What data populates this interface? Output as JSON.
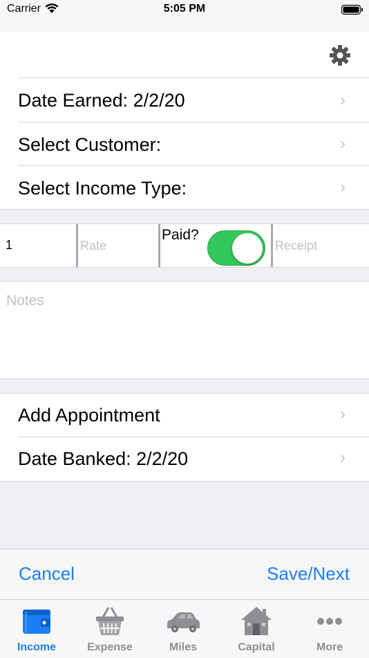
{
  "status_bar": {
    "carrier": "Carrier",
    "time": "5:05 PM"
  },
  "settings": {
    "icon": "gear-icon"
  },
  "rows_top": [
    {
      "label": "Date Earned: 2/2/20"
    },
    {
      "label": "Select Customer:"
    },
    {
      "label": "Select Income Type:"
    }
  ],
  "entry": {
    "quantity": "1",
    "rate_placeholder": "Rate",
    "paid_label": "Paid?",
    "paid_on": true,
    "receipt_placeholder": "Receipt"
  },
  "notes": {
    "placeholder": "Notes"
  },
  "rows_bottom": [
    {
      "label": "Add Appointment"
    },
    {
      "label": "Date Banked: 2/2/20"
    }
  ],
  "toolbar": {
    "cancel_label": "Cancel",
    "save_label": "Save/Next"
  },
  "tabs": [
    {
      "label": "Income",
      "icon": "wallet-icon",
      "active": true
    },
    {
      "label": "Expense",
      "icon": "basket-icon",
      "active": false
    },
    {
      "label": "Miles",
      "icon": "car-icon",
      "active": false
    },
    {
      "label": "Capital",
      "icon": "house-icon",
      "active": false
    },
    {
      "label": "More",
      "icon": "more-icon",
      "active": false
    }
  ],
  "colors": {
    "accent": "#1a7ef5",
    "toggle_on": "#34c759",
    "tab_inactive": "#8e8e93"
  }
}
